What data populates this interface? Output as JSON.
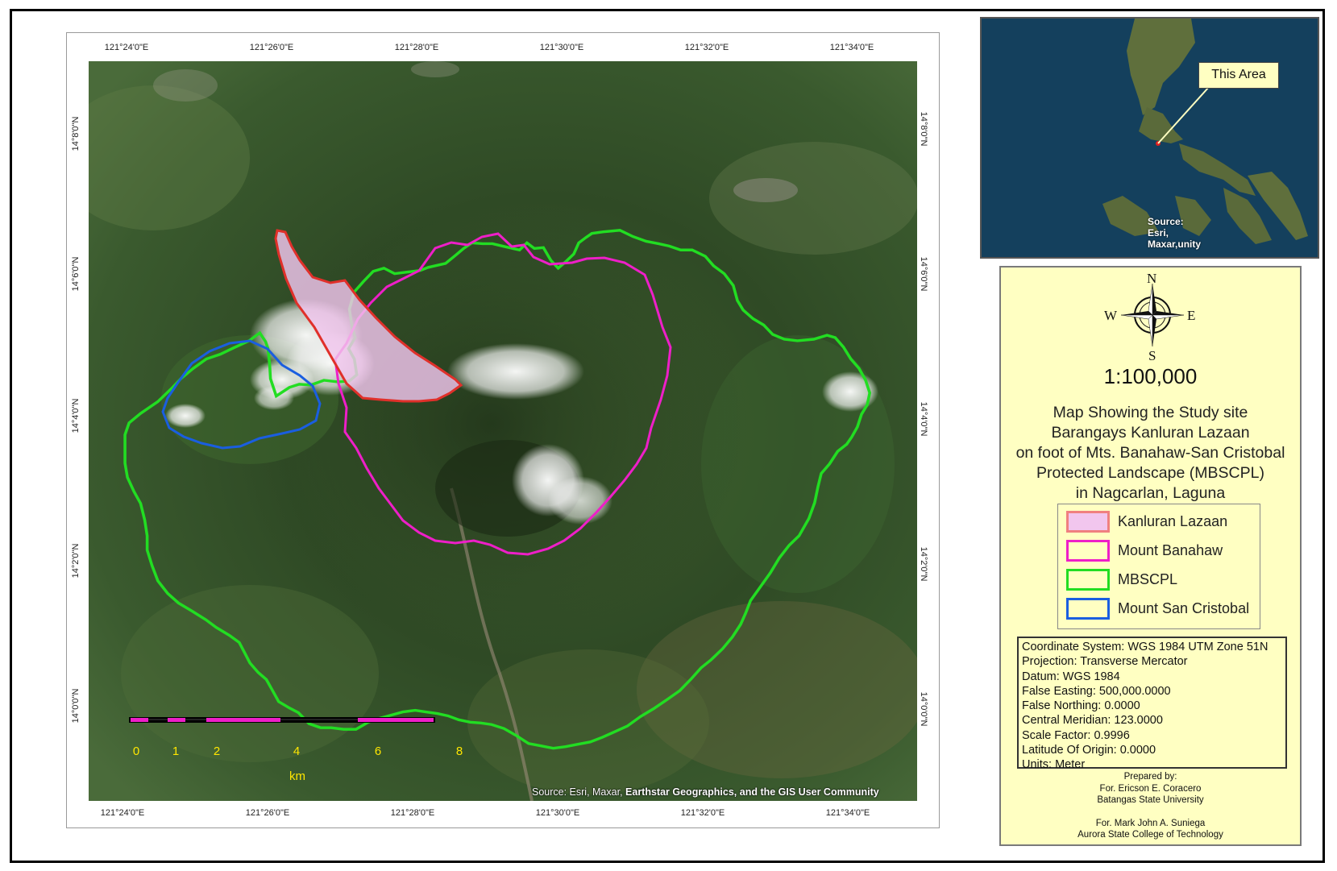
{
  "map": {
    "top_ticks": [
      "121°24'0\"E",
      "121°26'0\"E",
      "121°28'0\"E",
      "121°30'0\"E",
      "121°32'0\"E",
      "121°34'0\"E"
    ],
    "bottom_ticks": [
      "121°24'0\"E",
      "121°26'0\"E",
      "121°28'0\"E",
      "121°30'0\"E",
      "121°32'0\"E",
      "121°34'0\"E"
    ],
    "left_ticks": [
      "14°8'0\"N",
      "14°6'0\"N",
      "14°4'0\"N",
      "14°2'0\"N",
      "14°0'0\"N"
    ],
    "right_ticks": [
      "14°8'0\"N",
      "14°6'0\"N",
      "14°4'0\"N",
      "14°2'0\"N",
      "14°0'0\"N"
    ],
    "scale_bar_numbers": [
      "0",
      "1",
      "2",
      "4",
      "6",
      "8"
    ],
    "scale_bar_unit": "km",
    "source_plain": "Source: Esri, Maxar,",
    "source_bold": "Earthstar Geographics, and the GIS User Community",
    "colors": {
      "kanluran_lazaan": "#e0302a",
      "mount_banahaw": "#ee1fc8",
      "mbscpl": "#22dd22",
      "mount_san_cristobal": "#1a5ee0",
      "scale_bar_fill": "#ee1fc8",
      "scale_text": "#ffe600"
    }
  },
  "inset": {
    "callout_label": "This Area",
    "source_lines": [
      "Source:",
      "Esri,",
      "Maxar,unity"
    ]
  },
  "legend": {
    "compass": {
      "n": "N",
      "s": "S",
      "e": "E",
      "w": "W"
    },
    "scale": "1:100,000",
    "title_lines": [
      "Map Showing the Study site",
      "Barangays Kanluran Lazaan",
      "on foot of Mts. Banahaw-San Cristobal",
      "Protected Landscape (MBSCPL)",
      "in Nagcarlan, Laguna"
    ],
    "items": [
      {
        "label": "Kanluran Lazaan",
        "border": "#f08080",
        "fill": "#f2c6ee"
      },
      {
        "label": "Mount Banahaw",
        "border": "#ee1fc8",
        "fill": "#ffffc2"
      },
      {
        "label": "MBSCPL",
        "border": "#22dd22",
        "fill": "#ffffc2"
      },
      {
        "label": "Mount San Cristobal",
        "border": "#1a5ee0",
        "fill": "#ffffc2"
      }
    ],
    "coordinate_info": [
      "Coordinate System: WGS 1984 UTM Zone 51N",
      "Projection: Transverse Mercator",
      "Datum: WGS 1984",
      "False Easting: 500,000.0000",
      "False Northing: 0.0000",
      "Central Meridian: 123.0000",
      "Scale Factor: 0.9996",
      "Latitude Of Origin: 0.0000",
      "Units: Meter"
    ],
    "prepared_by": [
      "Prepared by:",
      "For. Ericson E. Coracero",
      "Batangas State University",
      "",
      "For. Mark John A. Suniega",
      "Aurora State College of Technology"
    ]
  }
}
